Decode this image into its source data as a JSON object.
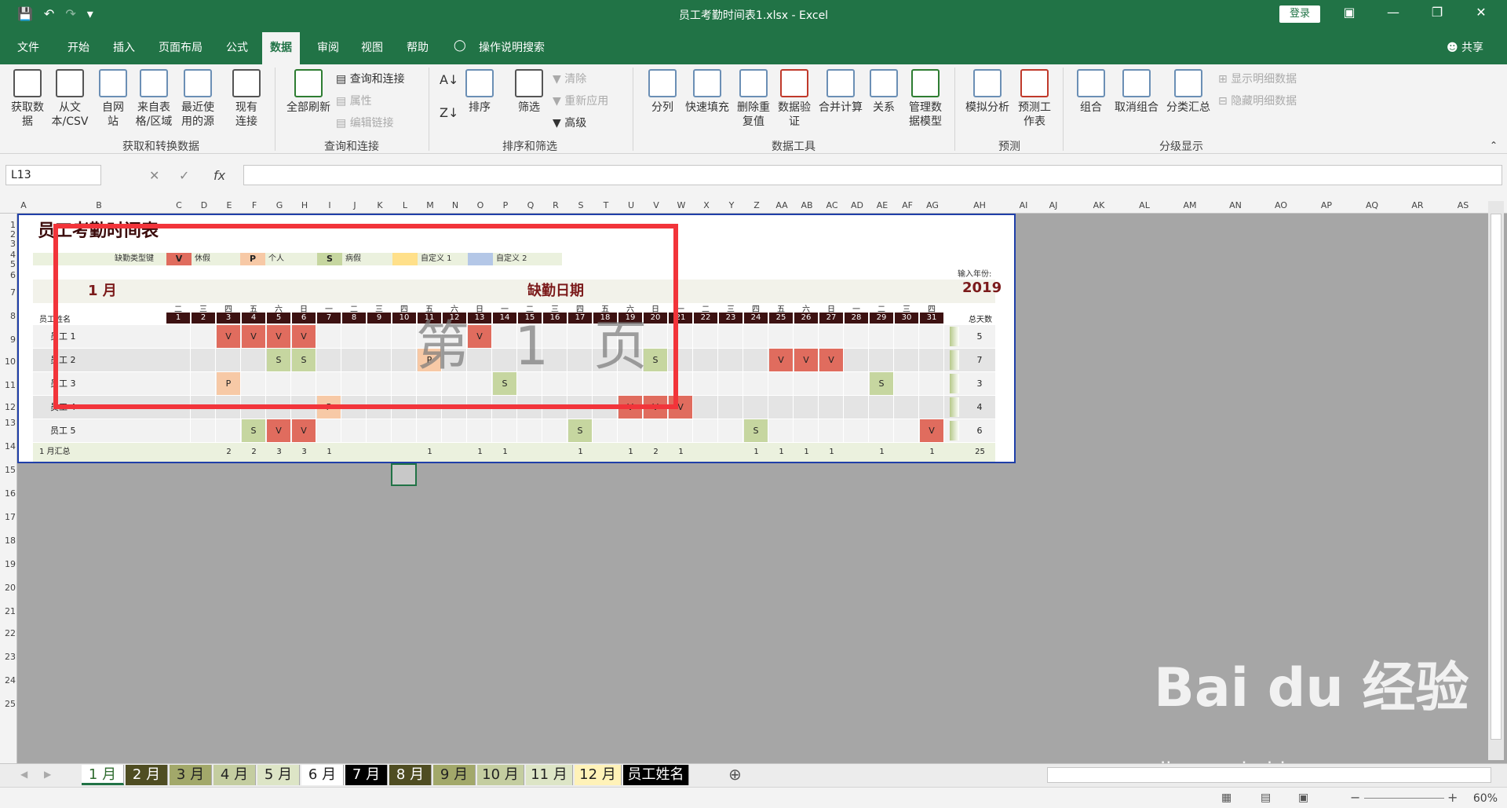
{
  "window": {
    "title": "员工考勤时间表1.xlsx  -  Excel",
    "login": "登录"
  },
  "menu": {
    "items": [
      "文件",
      "开始",
      "插入",
      "页面布局",
      "公式",
      "数据",
      "审阅",
      "视图",
      "帮助",
      "操作说明搜索"
    ],
    "active": "数据",
    "share": "共享"
  },
  "ribbon": {
    "get_data": "获取数据",
    "from_text": "从文本/CSV",
    "from_web": "自网站",
    "from_table": "来自表格/区域",
    "recent": "最近使用的源",
    "existing": "现有连接",
    "refresh": "全部刷新",
    "queries": "查询和连接",
    "props": "属性",
    "edit_links": "编辑链接",
    "sort": "排序",
    "filter": "筛选",
    "clear": "清除",
    "reapply": "重新应用",
    "advanced": "高级",
    "text_to_col": "分列",
    "flash_fill": "快速填充",
    "remove_dup": "删除重复值",
    "validation": "数据验证",
    "consolidate": "合并计算",
    "relations": "关系",
    "data_model": "管理数据模型",
    "whatif": "模拟分析",
    "forecast": "预测工作表",
    "group": "组合",
    "ungroup": "取消组合",
    "subtotal": "分类汇总",
    "show_detail": "显示明细数据",
    "hide_detail": "隐藏明细数据",
    "groups": [
      "获取和转换数据",
      "查询和连接",
      "排序和筛选",
      "数据工具",
      "预测",
      "分级显示"
    ]
  },
  "formula_bar": {
    "name_box": "L13",
    "fx": "fx"
  },
  "columns": [
    "A",
    "B",
    "C",
    "D",
    "E",
    "F",
    "G",
    "H",
    "I",
    "J",
    "K",
    "L",
    "M",
    "N",
    "O",
    "P",
    "Q",
    "R",
    "S",
    "T",
    "U",
    "V",
    "W",
    "X",
    "Y",
    "Z",
    "AA",
    "AB",
    "AC",
    "AD",
    "AE",
    "AF",
    "AG",
    "AH",
    "AI",
    "AJ",
    "AK",
    "AL",
    "AM",
    "AN",
    "AO",
    "AP",
    "AQ",
    "AR",
    "AS"
  ],
  "rows": [
    "1",
    "2",
    "3",
    "4",
    "5",
    "6",
    "7",
    "8",
    "9",
    "10",
    "11",
    "12",
    "13",
    "14",
    "15",
    "16",
    "17",
    "18",
    "19",
    "20",
    "21",
    "22",
    "23",
    "24",
    "25"
  ],
  "sheet": {
    "title": "员工考勤时间表",
    "legend": {
      "label": "缺勤类型键",
      "items": [
        {
          "code": "V",
          "name": "休假",
          "color": "#e06c5e"
        },
        {
          "code": "P",
          "name": "个人",
          "color": "#f7c9a6"
        },
        {
          "code": "S",
          "name": "病假",
          "color": "#c6d6a0"
        },
        {
          "code": "",
          "name": "自定义 1",
          "color": "#ffe08a"
        },
        {
          "code": "",
          "name": "自定义 2",
          "color": "#b4c7e7"
        }
      ]
    },
    "year_label": "输入年份:",
    "year": "2019",
    "month": "1 月",
    "absence_title": "缺勤日期",
    "header_name": "员工姓名",
    "header_total": "总天数",
    "weekdays": [
      "二",
      "三",
      "四",
      "五",
      "六",
      "日",
      "一",
      "二",
      "三",
      "四",
      "五",
      "六",
      "日",
      "一",
      "二",
      "三",
      "四",
      "五",
      "六",
      "日",
      "一",
      "二",
      "三",
      "四",
      "五",
      "六",
      "日",
      "一",
      "二",
      "三",
      "四"
    ],
    "days": [
      "1",
      "2",
      "3",
      "4",
      "5",
      "6",
      "7",
      "8",
      "9",
      "10",
      "11",
      "12",
      "13",
      "14",
      "15",
      "16",
      "17",
      "18",
      "19",
      "20",
      "21",
      "22",
      "23",
      "24",
      "25",
      "26",
      "27",
      "28",
      "29",
      "30",
      "31"
    ],
    "employees": [
      {
        "name": "员工 1",
        "total": "5",
        "marks": {
          "3": "V",
          "4": "V",
          "5": "V",
          "6": "V",
          "13": "V"
        }
      },
      {
        "name": "员工 2",
        "total": "7",
        "marks": {
          "5": "S",
          "6": "S",
          "11": "P",
          "20": "S",
          "25": "V",
          "26": "V",
          "27": "V"
        }
      },
      {
        "name": "员工 3",
        "total": "3",
        "marks": {
          "3": "P",
          "14": "S",
          "29": "S"
        }
      },
      {
        "name": "员工 4",
        "total": "4",
        "marks": {
          "7": "P",
          "19": "V",
          "20": "V",
          "21": "V"
        }
      },
      {
        "name": "员工 5",
        "total": "6",
        "marks": {
          "4": "S",
          "5": "V",
          "6": "V",
          "17": "S",
          "24": "S",
          "31": "V"
        }
      }
    ],
    "summary_label": "1 月汇总",
    "summary": {
      "3": "2",
      "4": "2",
      "5": "3",
      "6": "3",
      "7": "1",
      "11": "1",
      "13": "1",
      "14": "1",
      "17": "1",
      "19": "1",
      "20": "2",
      "21": "1",
      "24": "1",
      "25": "1",
      "26": "1",
      "27": "1",
      "29": "1",
      "31": "1"
    },
    "summary_total": "25"
  },
  "watermark": {
    "page": "第 1 页",
    "brand": "Bai du 经验",
    "url": "jingyan.baidu.com"
  },
  "tabs": [
    {
      "label": "1 月",
      "bg": "#ffffff",
      "fg": "#2e6b2e"
    },
    {
      "label": "2 月",
      "bg": "#4f4d22",
      "fg": "#ffffff"
    },
    {
      "label": "3 月",
      "bg": "#a2a86a",
      "fg": "#222222"
    },
    {
      "label": "4 月",
      "bg": "#c4cda0",
      "fg": "#222222"
    },
    {
      "label": "5 月",
      "bg": "#dde5c6",
      "fg": "#222222"
    },
    {
      "label": "6 月",
      "bg": "#ffffff",
      "fg": "#222222"
    },
    {
      "label": "7 月",
      "bg": "#000000",
      "fg": "#ffffff"
    },
    {
      "label": "8 月",
      "bg": "#4f4d22",
      "fg": "#ffffff"
    },
    {
      "label": "9 月",
      "bg": "#a2a86a",
      "fg": "#222222"
    },
    {
      "label": "10 月",
      "bg": "#c4cda0",
      "fg": "#222222"
    },
    {
      "label": "11 月",
      "bg": "#dde5c6",
      "fg": "#222222"
    },
    {
      "label": "12 月",
      "bg": "#fff2b8",
      "fg": "#222222"
    },
    {
      "label": "员工姓名",
      "bg": "#000000",
      "fg": "#ffffff"
    }
  ],
  "status": {
    "zoom": "60%"
  }
}
